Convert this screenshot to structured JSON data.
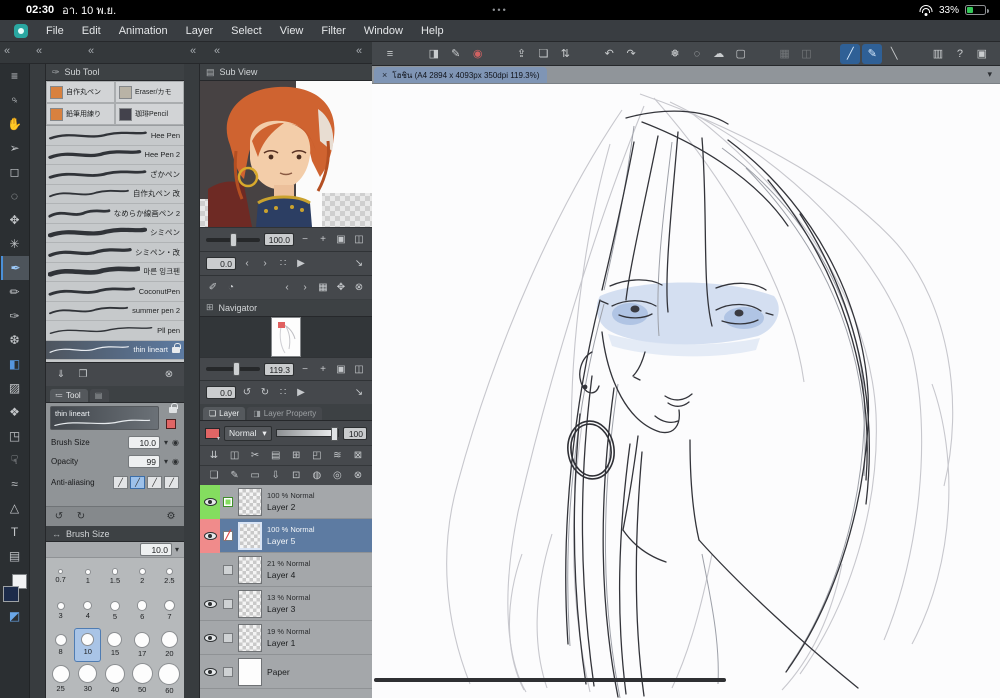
{
  "colors": {
    "accent_blue": "#5d7ba2",
    "selection_blue": "#4a90d9",
    "layer_green": "#84dd5f",
    "layer_red": "#f08b8b",
    "blend_swatch_red": "#e06565",
    "battery_green": "#35c759",
    "main_color_swatch": "#1c2b4a"
  },
  "status_bar": {
    "time": "02:30",
    "date": "อา. 10 พ.ย.",
    "center_dots": "•••",
    "battery_percent": "33%"
  },
  "menu_bar": [
    "File",
    "Edit",
    "Animation",
    "Layer",
    "Select",
    "View",
    "Filter",
    "Window",
    "Help"
  ],
  "toolbar": [
    {
      "name": "main-menu-icon",
      "glyph": "≡"
    },
    {
      "name": "sep",
      "sep": true
    },
    {
      "name": "canvas-settings-icon",
      "glyph": "◨"
    },
    {
      "name": "pen-settings-icon",
      "glyph": "✎"
    },
    {
      "name": "anti-overflow-icon",
      "glyph": "◉",
      "color": "#d06262"
    },
    {
      "name": "sep",
      "sep": true
    },
    {
      "name": "export-icon",
      "glyph": "⇪"
    },
    {
      "name": "open-file-icon",
      "glyph": "❏"
    },
    {
      "name": "swap-icon",
      "glyph": "⇅"
    },
    {
      "name": "sep",
      "sep": true
    },
    {
      "name": "undo-icon",
      "glyph": "↶"
    },
    {
      "name": "redo-icon",
      "glyph": "↷"
    },
    {
      "name": "sep",
      "sep": true
    },
    {
      "name": "filter-icon",
      "glyph": "❅"
    },
    {
      "name": "deselect-icon",
      "glyph": "◌"
    },
    {
      "name": "fill-icon",
      "glyph": "☁"
    },
    {
      "name": "crop-icon",
      "glyph": "▢"
    },
    {
      "name": "sep",
      "sep": true
    },
    {
      "name": "select-tone-icon",
      "glyph": "▦",
      "disabled": true
    },
    {
      "name": "select-layer-icon",
      "glyph": "◫",
      "disabled": true
    },
    {
      "name": "sep",
      "sep": true
    },
    {
      "name": "snap-ruler-icon",
      "glyph": "╱",
      "active": true
    },
    {
      "name": "snap-curve-icon",
      "glyph": "✎",
      "active": true
    },
    {
      "name": "snap-special-icon",
      "glyph": "╲"
    },
    {
      "name": "sep",
      "sep": true
    },
    {
      "name": "reference-icon",
      "glyph": "▥"
    },
    {
      "name": "help-icon",
      "glyph": "?"
    },
    {
      "name": "fullscreen-icon",
      "glyph": "▣"
    }
  ],
  "tool_strip": [
    {
      "name": "strip-menu-icon",
      "glyph": "≡"
    },
    {
      "name": "zoom-tool",
      "glyph": "♀",
      "rot": true
    },
    {
      "name": "hand-tool",
      "glyph": "✋"
    },
    {
      "name": "operation-tool",
      "glyph": "➢"
    },
    {
      "name": "selection-tool",
      "glyph": "◻"
    },
    {
      "name": "lasso-tool",
      "glyph": "◌"
    },
    {
      "name": "move-tool",
      "glyph": "✥"
    },
    {
      "name": "auto-select-tool",
      "glyph": "✳"
    },
    {
      "name": "pen-tool",
      "glyph": "✒",
      "selected": true
    },
    {
      "name": "pencil-tool",
      "glyph": "✏"
    },
    {
      "name": "brush-tool",
      "glyph": "✑"
    },
    {
      "name": "airbrush-tool",
      "glyph": "❆"
    },
    {
      "name": "fill-tool",
      "glyph": "◧",
      "color": "#5596e0"
    },
    {
      "name": "gradient-tool",
      "glyph": "▨"
    },
    {
      "name": "decoration-tool",
      "glyph": "❖"
    },
    {
      "name": "eraser-tool",
      "glyph": "◳"
    },
    {
      "name": "blend-tool",
      "glyph": "☟"
    },
    {
      "name": "liquify-tool",
      "glyph": "≈"
    },
    {
      "name": "figure-tool",
      "glyph": "△"
    },
    {
      "name": "text-tool",
      "glyph": "T"
    },
    {
      "name": "frame-tool",
      "glyph": "▤"
    }
  ],
  "subtool": {
    "title": "Sub Tool",
    "presets": [
      {
        "label": "自作丸ペン",
        "thumb": "#d8813f"
      },
      {
        "label": "Eraser/カモ",
        "thumb": "#b9b3a6"
      },
      {
        "label": "鉛筆用練り",
        "thumb": "#d8813f"
      },
      {
        "label": "珈琲Pencil",
        "thumb": "#43424c"
      }
    ],
    "brushes": [
      {
        "label": "Hee Pen",
        "w": 2.5
      },
      {
        "label": "Hee Pen 2",
        "w": 3.5
      },
      {
        "label": "ざかペン",
        "w": 3
      },
      {
        "label": "自作丸ペン 改",
        "w": 2
      },
      {
        "label": "なめらか線画ペン 2",
        "w": 3
      },
      {
        "label": "シミペン",
        "w": 4.5
      },
      {
        "label": "シミペン・改",
        "w": 3.5
      },
      {
        "label": "마른 잉크펜",
        "w": 5
      },
      {
        "label": "CoconutPen",
        "w": 3
      },
      {
        "label": "summer pen 2",
        "w": 2
      },
      {
        "label": "Pll pen",
        "w": 1.5
      },
      {
        "label": "thin lineart",
        "w": 1.3,
        "selected": true,
        "locked": true
      }
    ],
    "footer_icons": [
      {
        "name": "import-subtool-icon",
        "glyph": "⇓"
      },
      {
        "name": "duplicate-subtool-icon",
        "glyph": "❐"
      },
      {
        "name": "delete-subtool-icon",
        "glyph": "⊗"
      }
    ]
  },
  "tool_property": {
    "tab_label": "Tool",
    "brush_name": "thin lineart",
    "rows": [
      {
        "label": "Brush Size",
        "value": "10.0"
      },
      {
        "label": "Opacity",
        "value": "99"
      }
    ],
    "anti_aliasing_label": "Anti-aliasing",
    "footer_icons": [
      {
        "name": "reset-icon",
        "glyph": "↺"
      },
      {
        "name": "reset-all-icon",
        "glyph": "↻"
      },
      {
        "name": "wrench-icon",
        "glyph": "⚙"
      }
    ]
  },
  "brush_size_panel": {
    "title": "Brush Size",
    "current": "10.0",
    "sizes": [
      {
        "v": "0.7",
        "d": "3px"
      },
      {
        "v": "1",
        "d": "4px"
      },
      {
        "v": "1.5",
        "d": "4.5px"
      },
      {
        "v": "2",
        "d": "5px"
      },
      {
        "v": "2.5",
        "d": "5.5px"
      },
      {
        "v": "3",
        "d": "6px"
      },
      {
        "v": "4",
        "d": "7px"
      },
      {
        "v": "5",
        "d": "8px"
      },
      {
        "v": "6",
        "d": "8.5px"
      },
      {
        "v": "7",
        "d": "9px"
      },
      {
        "v": "8",
        "d": "10px"
      },
      {
        "v": "10",
        "d": "11px",
        "selected": true
      },
      {
        "v": "15",
        "d": "13px"
      },
      {
        "v": "17",
        "d": "14px"
      },
      {
        "v": "20",
        "d": "15px"
      },
      {
        "v": "25",
        "d": "16px"
      },
      {
        "v": "30",
        "d": "17px"
      },
      {
        "v": "40",
        "d": "18px"
      },
      {
        "v": "50",
        "d": "19px"
      },
      {
        "v": "60",
        "d": "20px"
      }
    ]
  },
  "subview": {
    "title": "Sub View",
    "zoom": "100.0",
    "rotation": "0.0"
  },
  "navigator": {
    "title": "Navigator",
    "zoom": "119.3",
    "rotation": "0.0"
  },
  "layer_panel": {
    "tab_active": "Layer",
    "tab_inactive": "Layer Property",
    "blend_mode": "Normal",
    "blend_caret": "▾",
    "opacity": "100",
    "action_icons_row1": [
      {
        "name": "blend-down-icon",
        "glyph": "⇊"
      },
      {
        "name": "copy-layer-icon",
        "glyph": "◫"
      },
      {
        "name": "cut-icon",
        "glyph": "✂"
      },
      {
        "name": "paste-icon",
        "glyph": "▤"
      },
      {
        "name": "merge-icon",
        "glyph": "⊞"
      },
      {
        "name": "clip-icon",
        "glyph": "◰"
      },
      {
        "name": "ruler-icon",
        "glyph": "≋"
      },
      {
        "name": "lock-cells-icon",
        "glyph": "⊠"
      }
    ],
    "action_icons_row2": [
      {
        "name": "new-raster-layer-icon",
        "glyph": "❏"
      },
      {
        "name": "new-vector-layer-icon",
        "glyph": "✎"
      },
      {
        "name": "new-folder-icon",
        "glyph": "▭"
      },
      {
        "name": "transfer-icon",
        "glyph": "⇩"
      },
      {
        "name": "combine-icon",
        "glyph": "⊡"
      },
      {
        "name": "mask-icon",
        "glyph": "◍"
      },
      {
        "name": "apply-mask-icon",
        "glyph": "◎"
      },
      {
        "name": "delete-layer-icon",
        "glyph": "⊗"
      }
    ],
    "layers": [
      {
        "op": "100 %  Normal",
        "name": "Layer 2",
        "eyeG": true,
        "badgeG": true
      },
      {
        "op": "100 %  Normal",
        "name": "Layer 5",
        "eyeR": true,
        "badgeR": true,
        "sel": true
      },
      {
        "op": "21 %  Normal",
        "name": "Layer 4",
        "eyeOff": true
      },
      {
        "op": "13 %  Normal",
        "name": "Layer 3"
      },
      {
        "op": "19 %  Normal",
        "name": "Layer 1"
      },
      {
        "op": "",
        "name": "Paper",
        "thumbWhite": true,
        "paper": true
      }
    ]
  },
  "canvas": {
    "close": "×",
    "tab_title": "โฮชิน (A4 2894 x 4093px 350dpi 119.3%)",
    "chevron": "▾"
  }
}
